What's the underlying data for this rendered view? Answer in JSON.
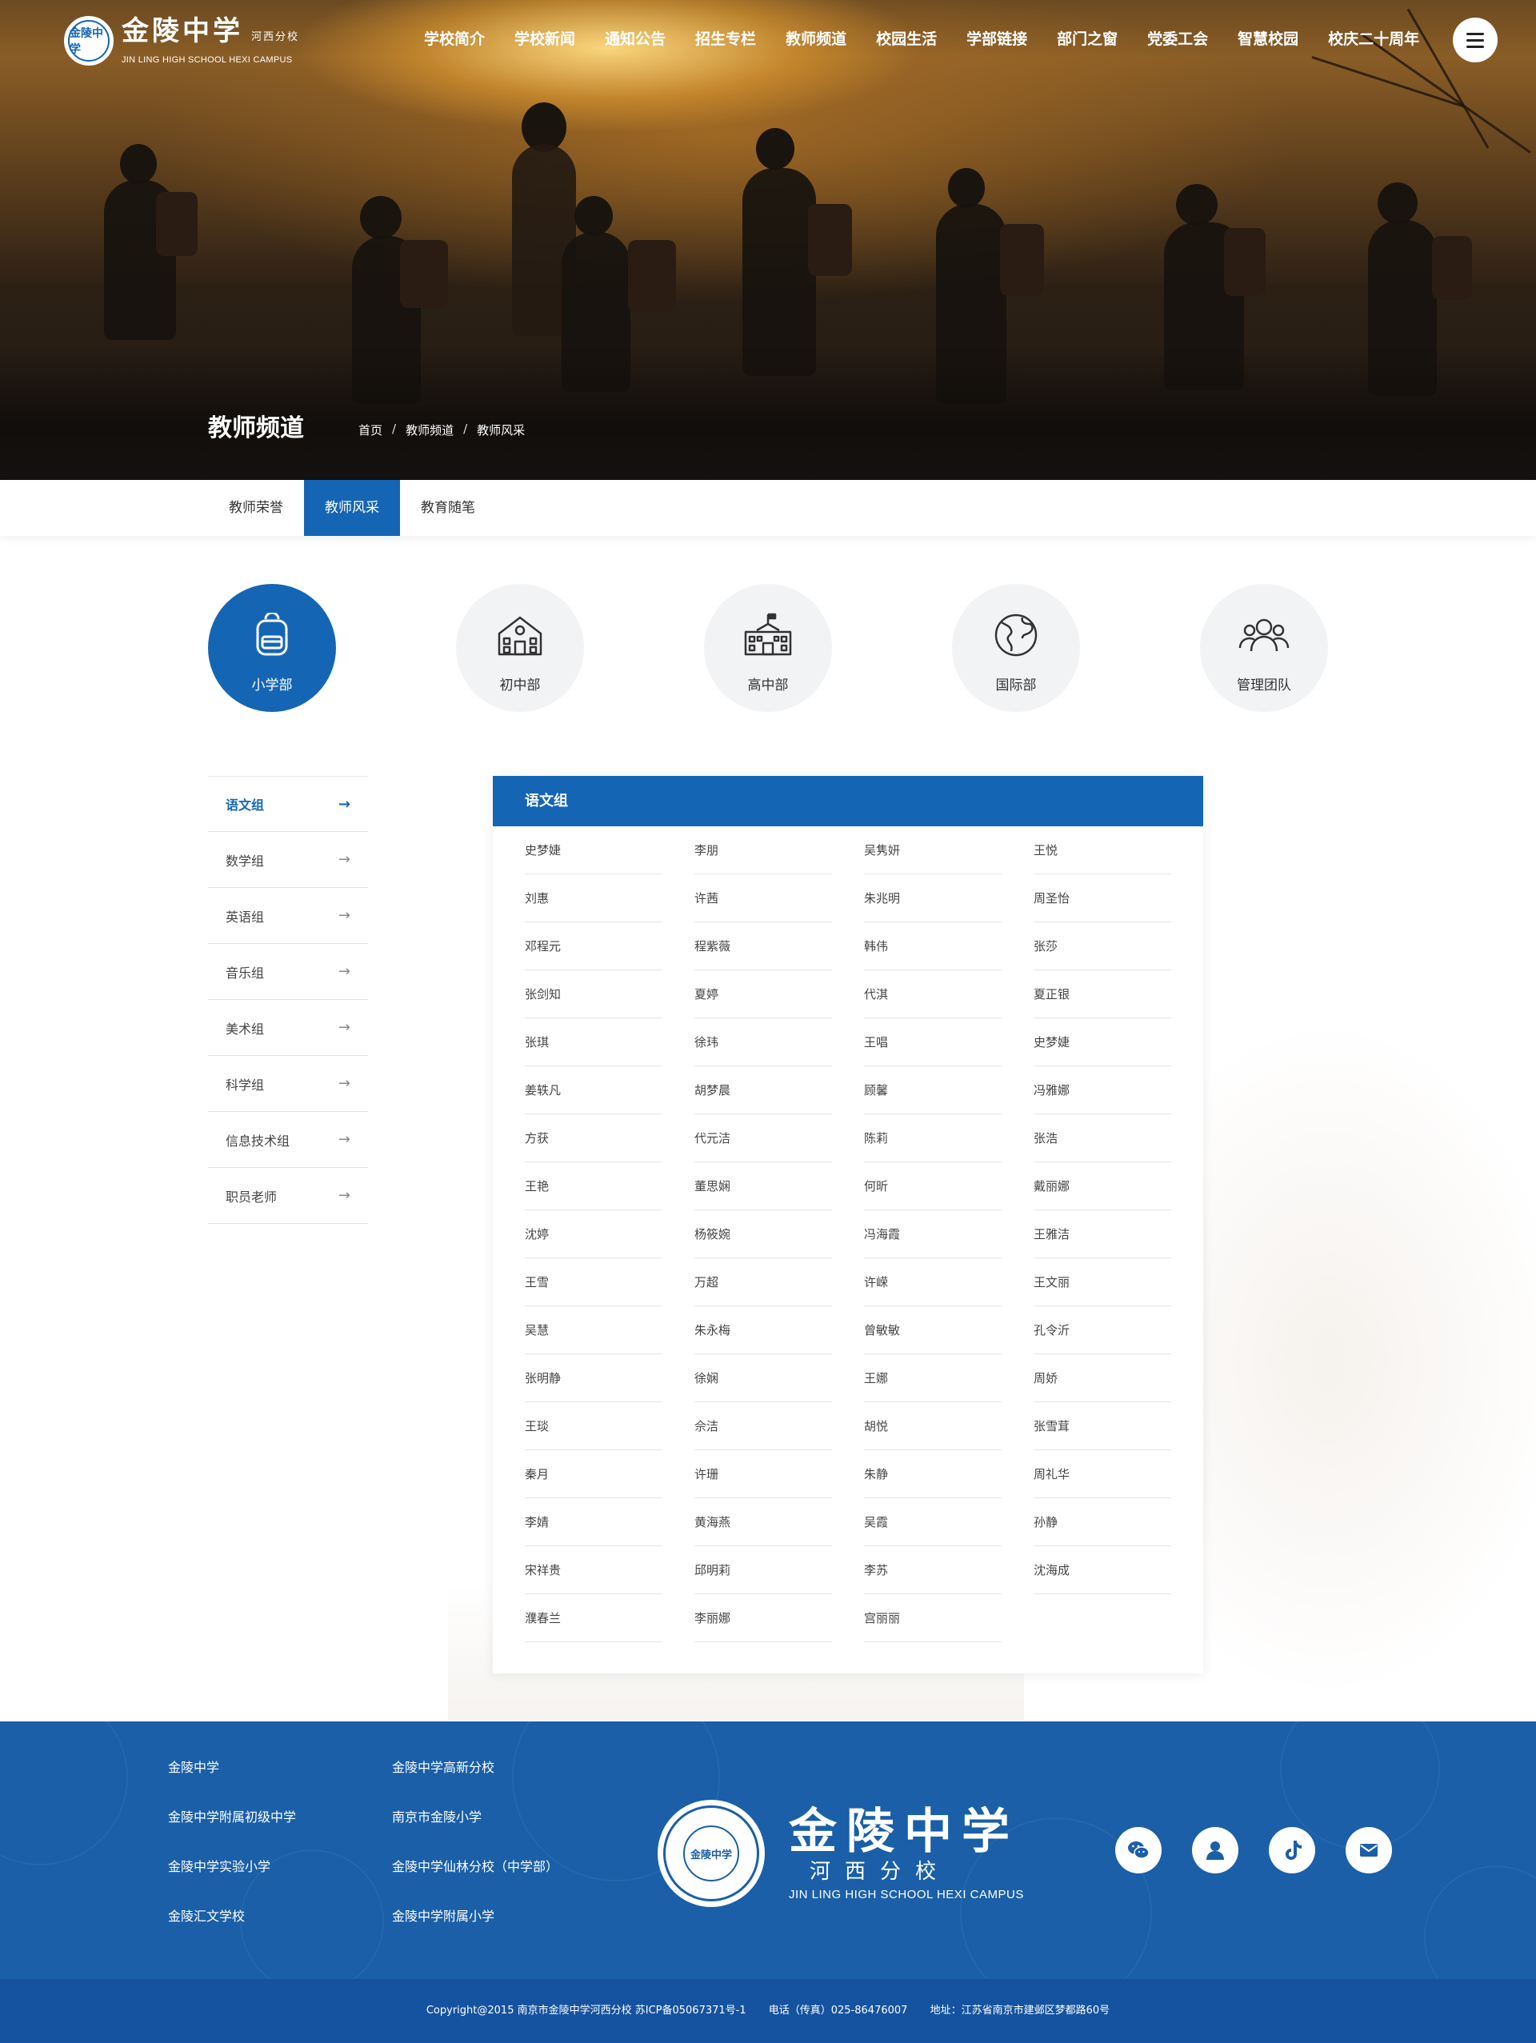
{
  "header": {
    "logo_cn": "金陵中学",
    "logo_sub": "河西分校",
    "logo_en": "JIN LING HIGH SCHOOL HEXI CAMPUS",
    "seal_text": "金陵中学",
    "nav": [
      "学校简介",
      "学校新闻",
      "通知公告",
      "招生专栏",
      "教师频道",
      "校园生活",
      "学部链接",
      "部门之窗",
      "党委工会",
      "智慧校园",
      "校庆二十周年"
    ],
    "menu_icon": "hamburger-menu-icon"
  },
  "hero": {
    "title": "教师频道",
    "breadcrumb": [
      "首页",
      "教师频道",
      "教师风采"
    ],
    "separator": "/"
  },
  "subtabs": {
    "items": [
      "教师荣誉",
      "教师风采",
      "教育随笔"
    ],
    "active": 1
  },
  "divisions": {
    "items": [
      {
        "label": "小学部",
        "icon": "backpack-icon"
      },
      {
        "label": "初中部",
        "icon": "school-building-icon"
      },
      {
        "label": "高中部",
        "icon": "school-flag-icon"
      },
      {
        "label": "国际部",
        "icon": "globe-icon"
      },
      {
        "label": "管理团队",
        "icon": "team-icon"
      }
    ],
    "active": 0
  },
  "sidebar": {
    "items": [
      "语文组",
      "数学组",
      "英语组",
      "音乐组",
      "美术组",
      "科学组",
      "信息技术组",
      "职员老师"
    ],
    "active": 0,
    "arrow": "→"
  },
  "panel": {
    "title": "语文组",
    "names": [
      "史梦婕",
      "李朋",
      "吴隽妍",
      "王悦",
      "刘惠",
      "许茜",
      "朱兆明",
      "周圣怡",
      "邓程元",
      "程紫薇",
      "韩伟",
      "张莎",
      "张剑知",
      "夏婷",
      "代淇",
      "夏正银",
      "张琪",
      "徐玮",
      "王唱",
      "史梦婕",
      "姜轶凡",
      "胡梦晨",
      "顾馨",
      "冯雅娜",
      "方获",
      "代元洁",
      "陈莉",
      "张浩",
      "王艳",
      "董思娴",
      "何昕",
      "戴丽娜",
      "沈婷",
      "杨筱婉",
      "冯海霞",
      "王雅洁",
      "王雪",
      "万超",
      "许嵘",
      "王文丽",
      "吴慧",
      "朱永梅",
      "曾敏敏",
      "孔令沂",
      "张明静",
      "徐娴",
      "王娜",
      "周娇",
      "王琰",
      "佘洁",
      "胡悦",
      "张雪茸",
      "秦月",
      "许珊",
      "朱静",
      "周礼华",
      "李婧",
      "黄海燕",
      "吴霞",
      "孙静",
      "宋祥贵",
      "邱明莉",
      "李苏",
      "沈海成",
      "濮春兰",
      "李丽娜",
      "宫丽丽"
    ]
  },
  "footer": {
    "links_col1": [
      "金陵中学",
      "金陵中学附属初级中学",
      "金陵中学实验小学",
      "金陵汇文学校"
    ],
    "links_col2": [
      "金陵中学高新分校",
      "南京市金陵小学",
      "金陵中学仙林分校（中学部）",
      "金陵中学附属小学"
    ],
    "seal_text": "金陵中学",
    "brand_cn": "金陵中学",
    "brand_sub": "河西分校",
    "brand_en": "JIN LING HIGH SCHOOL HEXI CAMPUS",
    "social": [
      "wechat-icon",
      "user-icon",
      "tiktok-icon",
      "mail-icon"
    ],
    "copyright": "Copyright@2015 南京市金陵中学河西分校  苏ICP备05067371号-1",
    "phone": "电话（传真）025-86476007",
    "address": "地址：江苏省南京市建邺区梦都路60号"
  },
  "colors": {
    "primary": "#1565b5",
    "footer": "#1a5fa8",
    "footer_bottom": "#1553a0"
  }
}
